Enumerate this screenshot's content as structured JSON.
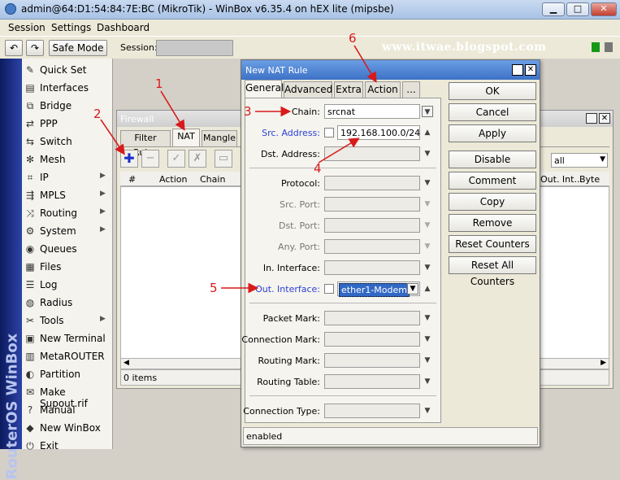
{
  "window": {
    "title": "admin@64:D1:54:84:7E:BC (MikroTik) - WinBox v6.35.4 on hEX lite (mipsbe)"
  },
  "menu": {
    "items": [
      "Session",
      "Settings",
      "Dashboard"
    ]
  },
  "toolbar": {
    "safe_mode": "Safe Mode",
    "session_label": "Session:"
  },
  "watermark": "www.itwae.blogspot.com",
  "brand_strip": "RouterOS WinBox",
  "sidebar": {
    "items": [
      {
        "label": "Quick Set",
        "icon": "quick-set-icon",
        "has_submenu": false
      },
      {
        "label": "Interfaces",
        "icon": "interfaces-icon",
        "has_submenu": false
      },
      {
        "label": "Bridge",
        "icon": "bridge-icon",
        "has_submenu": false
      },
      {
        "label": "PPP",
        "icon": "ppp-icon",
        "has_submenu": false
      },
      {
        "label": "Switch",
        "icon": "switch-icon",
        "has_submenu": false
      },
      {
        "label": "Mesh",
        "icon": "mesh-icon",
        "has_submenu": false
      },
      {
        "label": "IP",
        "icon": "ip-icon",
        "has_submenu": true
      },
      {
        "label": "MPLS",
        "icon": "mpls-icon",
        "has_submenu": true
      },
      {
        "label": "Routing",
        "icon": "routing-icon",
        "has_submenu": true
      },
      {
        "label": "System",
        "icon": "system-icon",
        "has_submenu": true
      },
      {
        "label": "Queues",
        "icon": "queues-icon",
        "has_submenu": false
      },
      {
        "label": "Files",
        "icon": "files-icon",
        "has_submenu": false
      },
      {
        "label": "Log",
        "icon": "log-icon",
        "has_submenu": false
      },
      {
        "label": "Radius",
        "icon": "radius-icon",
        "has_submenu": false
      },
      {
        "label": "Tools",
        "icon": "tools-icon",
        "has_submenu": true
      },
      {
        "label": "New Terminal",
        "icon": "terminal-icon",
        "has_submenu": false
      },
      {
        "label": "MetaROUTER",
        "icon": "metarouter-icon",
        "has_submenu": false
      },
      {
        "label": "Partition",
        "icon": "partition-icon",
        "has_submenu": false
      },
      {
        "label": "Make Supout.rif",
        "icon": "supout-icon",
        "has_submenu": false
      },
      {
        "label": "Manual",
        "icon": "manual-icon",
        "has_submenu": false
      },
      {
        "label": "New WinBox",
        "icon": "winbox-icon",
        "has_submenu": false
      },
      {
        "label": "Exit",
        "icon": "exit-icon",
        "has_submenu": false
      }
    ]
  },
  "firewall": {
    "title": "Firewall",
    "tabs": [
      "Filter Rules",
      "NAT",
      "Mangle"
    ],
    "active_tab": "NAT",
    "filter_value": "all",
    "columns": [
      "#",
      "Action",
      "Chain"
    ],
    "right_columns": [
      "Out. Int...",
      "Byte"
    ],
    "status": "0 items"
  },
  "dialog": {
    "title": "New NAT Rule",
    "tabs": [
      "General",
      "Advanced",
      "Extra",
      "Action",
      "..."
    ],
    "active_tab": "General",
    "fields": {
      "chain": {
        "label": "Chain:",
        "value": "srcnat"
      },
      "src_address": {
        "label": "Src. Address:",
        "value": "192.168.100.0/24"
      },
      "dst_address": {
        "label": "Dst. Address:",
        "value": ""
      },
      "protocol": {
        "label": "Protocol:",
        "value": ""
      },
      "src_port": {
        "label": "Src. Port:",
        "value": ""
      },
      "dst_port": {
        "label": "Dst. Port:",
        "value": ""
      },
      "any_port": {
        "label": "Any. Port:",
        "value": ""
      },
      "in_interface": {
        "label": "In. Interface:",
        "value": ""
      },
      "out_interface": {
        "label": "Out. Interface:",
        "value": "ether1-Modem"
      },
      "packet_mark": {
        "label": "Packet Mark:",
        "value": ""
      },
      "connection_mark": {
        "label": "Connection Mark:",
        "value": ""
      },
      "routing_mark": {
        "label": "Routing Mark:",
        "value": ""
      },
      "routing_table": {
        "label": "Routing Table:",
        "value": ""
      },
      "connection_type": {
        "label": "Connection Type:",
        "value": ""
      }
    },
    "buttons": [
      "OK",
      "Cancel",
      "Apply",
      "Disable",
      "Comment",
      "Copy",
      "Remove",
      "Reset Counters",
      "Reset All Counters"
    ],
    "status": "enabled"
  },
  "annotations": [
    "1",
    "2",
    "3",
    "4",
    "5",
    "6"
  ],
  "colors": {
    "annotation": "#d81a1a",
    "label_blue": "#2b3fd4",
    "title_blue": "#3d72c7"
  }
}
